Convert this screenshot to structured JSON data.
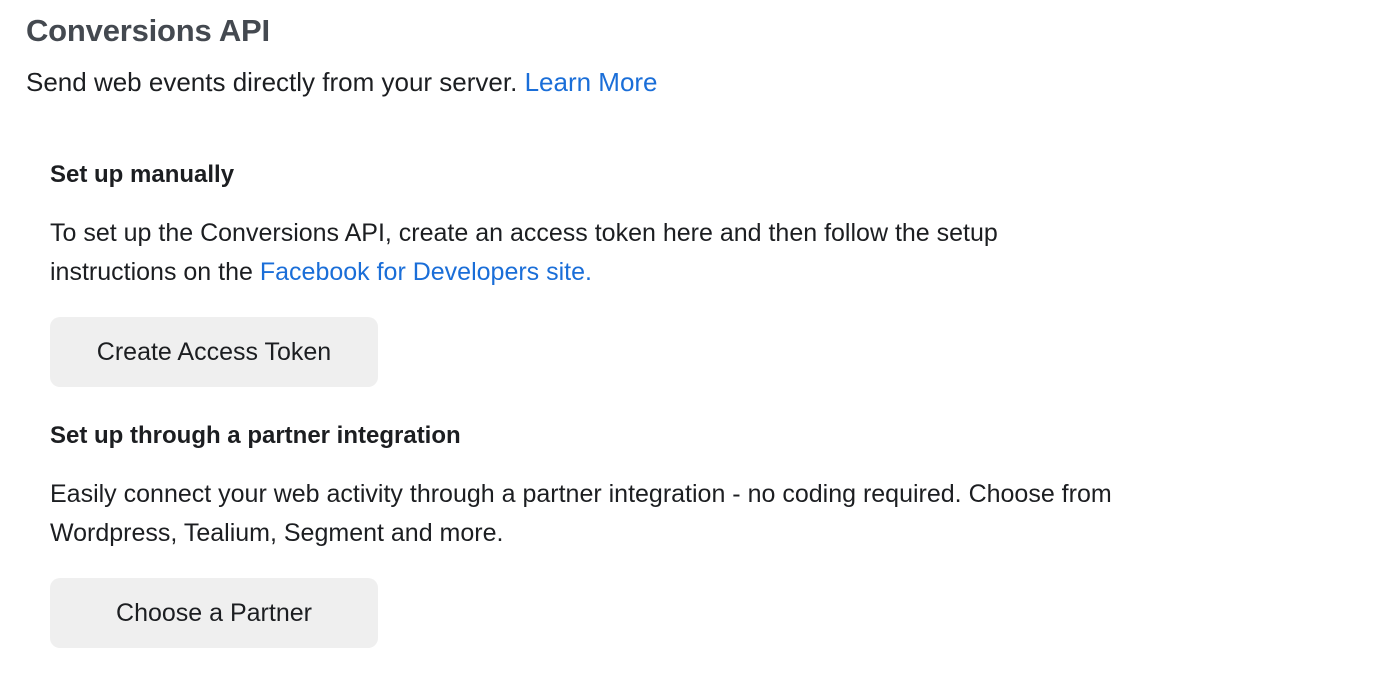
{
  "header": {
    "title": "Conversions API",
    "subtitle": "Send web events directly from your server.",
    "learn_more_link": "Learn More"
  },
  "manual_setup": {
    "heading": "Set up manually",
    "description_line1": "To set up the Conversions API, create an access token here and then follow the setup",
    "description_line2_prefix": "instructions on the",
    "developers_link": "Facebook for Developers site.",
    "button_label": "Create Access Token"
  },
  "partner_setup": {
    "heading": "Set up through a partner integration",
    "description_line1": "Easily connect your web activity through a partner integration - no coding required. Choose from",
    "description_line2": "Wordpress, Tealium, Segment and more.",
    "button_label": "Choose a Partner"
  },
  "colors": {
    "link": "#1a6ed8",
    "button_bg": "#efefef",
    "title": "#444950",
    "text": "#1c1e21"
  }
}
